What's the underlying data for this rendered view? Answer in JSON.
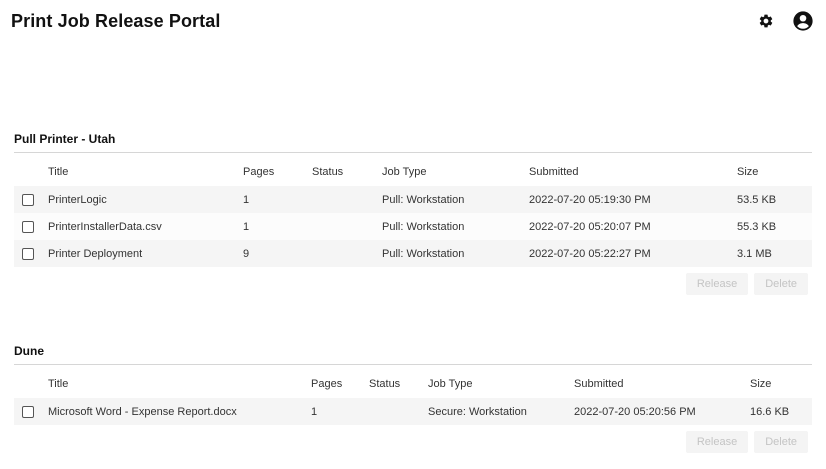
{
  "header": {
    "title": "Print Job Release Portal",
    "settings_icon": "gear-icon",
    "account_icon": "account-circle-icon"
  },
  "colors": {
    "text": "#222222",
    "row_odd": "#f5f5f5",
    "row_even": "#fcfcfc",
    "disabled_text": "#c4c4c4",
    "disabled_bg": "#f4f4f4"
  },
  "sections": [
    {
      "title": "Pull Printer - Utah",
      "columns": [
        "Title",
        "Pages",
        "Status",
        "Job Type",
        "Submitted",
        "Size"
      ],
      "rows": [
        {
          "title": "PrinterLogic",
          "pages": "1",
          "status": "",
          "job_type": "Pull: Workstation",
          "submitted": "2022-07-20 05:19:30 PM",
          "size": "53.5 KB"
        },
        {
          "title": "PrinterInstallerData.csv",
          "pages": "1",
          "status": "",
          "job_type": "Pull: Workstation",
          "submitted": "2022-07-20 05:20:07 PM",
          "size": "55.3 KB"
        },
        {
          "title": "Printer Deployment",
          "pages": "9",
          "status": "",
          "job_type": "Pull: Workstation",
          "submitted": "2022-07-20 05:22:27 PM",
          "size": "3.1 MB"
        }
      ],
      "release_label": "Release",
      "delete_label": "Delete"
    },
    {
      "title": "Dune",
      "columns": [
        "Title",
        "Pages",
        "Status",
        "Job Type",
        "Submitted",
        "Size"
      ],
      "rows": [
        {
          "title": "Microsoft Word - Expense Report.docx",
          "pages": "1",
          "status": "",
          "job_type": "Secure: Workstation",
          "submitted": "2022-07-20 05:20:56 PM",
          "size": "16.6 KB"
        }
      ],
      "release_label": "Release",
      "delete_label": "Delete"
    }
  ]
}
